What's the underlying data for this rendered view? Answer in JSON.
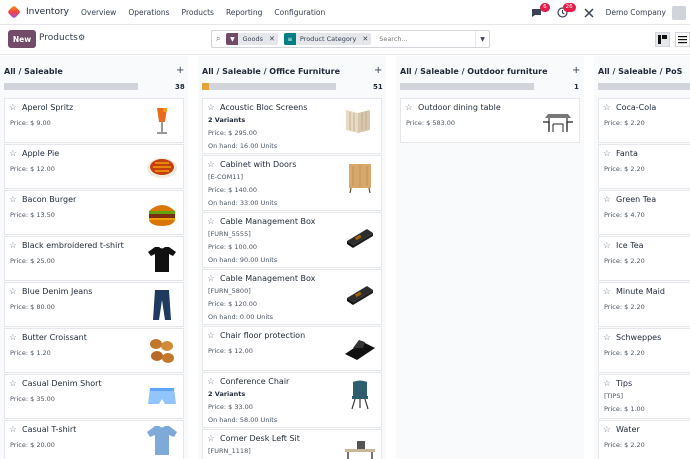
{
  "nav": {
    "app_name": "Inventory",
    "menus": [
      "Overview",
      "Operations",
      "Products",
      "Reporting",
      "Configuration"
    ],
    "messages_count": "6",
    "activities_count": "26",
    "company": "Demo Company",
    "icons": [
      "chat-icon",
      "clock-icon",
      "tools-icon"
    ]
  },
  "control": {
    "new_label": "New",
    "title": "Products",
    "facets": [
      {
        "label": "Goods",
        "icon": "filter-icon",
        "color": "#714b67"
      },
      {
        "label": "Product Category",
        "icon": "group-by-icon",
        "color": "#017e84"
      }
    ],
    "search_placeholder": "Search..."
  },
  "columns": [
    {
      "title": "All / Saleable",
      "count": "38",
      "progress": 0,
      "cards": [
        {
          "name": "Aperol Spritz",
          "lines": [
            "Price: $ 9.00"
          ],
          "img": "spritz"
        },
        {
          "name": "Apple Pie",
          "lines": [
            "Price: $ 12.00"
          ],
          "img": "pie"
        },
        {
          "name": "Bacon Burger",
          "lines": [
            "Price: $ 13.50"
          ],
          "img": "burger"
        },
        {
          "name": "Black embroidered t-shirt",
          "lines": [
            "Price: $ 25.00"
          ],
          "img": "tshirt-black"
        },
        {
          "name": "Blue Denim Jeans",
          "lines": [
            "Price: $ 80.00"
          ],
          "img": "jeans"
        },
        {
          "name": "Butter Croissant",
          "lines": [
            "Price: $ 1.20"
          ],
          "img": "croissant"
        },
        {
          "name": "Casual Denim Short",
          "lines": [
            "Price: $ 35.00"
          ],
          "img": "shorts"
        },
        {
          "name": "Casual T-shirt",
          "lines": [
            "Price: $ 20.00"
          ],
          "img": "tshirt-blue"
        }
      ]
    },
    {
      "title": "All / Saleable / Office Furniture",
      "count": "51",
      "progress": 0.05,
      "cards": [
        {
          "name": "Acoustic Bloc Screens",
          "lines": [
            "2 Variants",
            "Price: $ 295.00",
            "On hand: 16.00 Units"
          ],
          "img": "screens"
        },
        {
          "name": "Cabinet with Doors",
          "lines": [
            "[E-COM11]",
            "Price: $ 140.00",
            "On hand: 33.00 Units"
          ],
          "img": "cabinet"
        },
        {
          "name": "Cable Management Box",
          "lines": [
            "[FURN_5555]",
            "Price: $ 100.00",
            "On hand: 90.00 Units"
          ],
          "img": "cablebox"
        },
        {
          "name": "Cable Management Box",
          "lines": [
            "[FURN_5800]",
            "Price: $ 120.00",
            "On hand: 0.00 Units"
          ],
          "img": "cablebox"
        },
        {
          "name": "Chair floor protection",
          "lines": [
            "Price: $ 12.00"
          ],
          "img": "mat"
        },
        {
          "name": "Conference Chair",
          "lines": [
            "2 Variants",
            "Price: $ 33.00",
            "On hand: 58.00 Units"
          ],
          "img": "chair"
        },
        {
          "name": "Corner Desk Left Sit",
          "lines": [
            "[FURN_1118]"
          ],
          "img": "desk"
        }
      ]
    },
    {
      "title": "All / Saleable / Outdoor furniture",
      "count": "1",
      "progress": 0,
      "cards": [
        {
          "name": "Outdoor dining table",
          "lines": [
            "Price: $ 583.00"
          ],
          "img": "dining"
        }
      ]
    },
    {
      "title": "All / Saleable / PoS",
      "count": "",
      "progress": 0,
      "cards": [
        {
          "name": "Coca-Cola",
          "lines": [
            "Price: $ 2.20"
          ],
          "img": ""
        },
        {
          "name": "Fanta",
          "lines": [
            "Price: $ 2.20"
          ],
          "img": ""
        },
        {
          "name": "Green Tea",
          "lines": [
            "Price: $ 4.70"
          ],
          "img": ""
        },
        {
          "name": "Ice Tea",
          "lines": [
            "Price: $ 2.20"
          ],
          "img": ""
        },
        {
          "name": "Minute Maid",
          "lines": [
            "Price: $ 2.20"
          ],
          "img": ""
        },
        {
          "name": "Schweppes",
          "lines": [
            "Price: $ 2.20"
          ],
          "img": ""
        },
        {
          "name": "Tips",
          "lines": [
            "[TIPS]",
            "Price: $ 1.00"
          ],
          "img": ""
        },
        {
          "name": "Water",
          "lines": [
            "Price: $ 2.20"
          ],
          "img": ""
        }
      ]
    }
  ]
}
